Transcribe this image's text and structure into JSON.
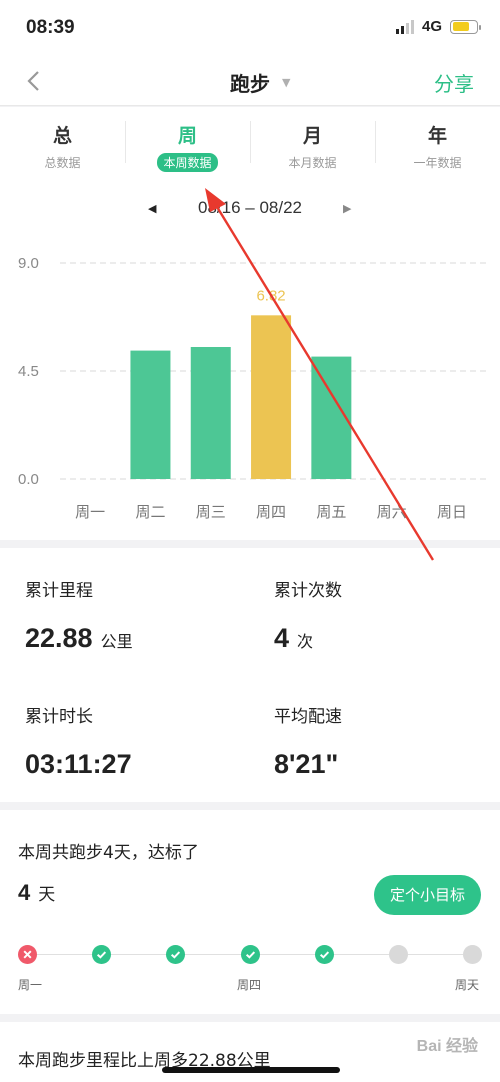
{
  "status": {
    "time": "08:39",
    "network": "4G",
    "battery_level": 0.7
  },
  "nav": {
    "title": "跑步",
    "share": "分享"
  },
  "tabs": [
    {
      "title": "总",
      "subtitle": "总数据"
    },
    {
      "title": "周",
      "subtitle": "本周数据",
      "active": true
    },
    {
      "title": "月",
      "subtitle": "本月数据"
    },
    {
      "title": "年",
      "subtitle": "一年数据"
    }
  ],
  "date_range": "08/16 – 08/22",
  "chart_data": {
    "type": "bar",
    "categories": [
      "周一",
      "周二",
      "周三",
      "周四",
      "周五",
      "周六",
      "周日"
    ],
    "values": [
      0,
      5.35,
      5.5,
      6.82,
      5.1,
      0,
      0
    ],
    "highlight_index": 3,
    "highlight_label": "6.82",
    "yticks": [
      "0.0",
      "4.5",
      "9.0"
    ],
    "ylim": [
      0,
      9
    ],
    "grid": "dashed",
    "colors": {
      "bar": "#4dc795",
      "highlight": "#ecc452",
      "label": "#ecc452"
    }
  },
  "stats": {
    "distance": {
      "label": "累计里程",
      "value": "22.88",
      "unit": "公里"
    },
    "count": {
      "label": "累计次数",
      "value": "4",
      "unit": "次"
    },
    "duration": {
      "label": "累计时长",
      "value": "03:11:27"
    },
    "pace": {
      "label": "平均配速",
      "value": "8'21\""
    }
  },
  "goal": {
    "text": "本周共跑步4天，达标了",
    "days": "4",
    "days_unit": "天",
    "button": "定个小目标",
    "labels": {
      "start": "周一",
      "middle": "周四",
      "end": "周天"
    },
    "days_status": [
      "fail",
      "done",
      "done",
      "done",
      "done",
      "empty",
      "empty"
    ]
  },
  "compare": {
    "text": "本周跑步里程比上周多22.88公里"
  },
  "watermark": "Bai 经验",
  "colors": {
    "accent": "#2dbf87",
    "fail": "#f0596a",
    "annotation": "#e8392e"
  }
}
